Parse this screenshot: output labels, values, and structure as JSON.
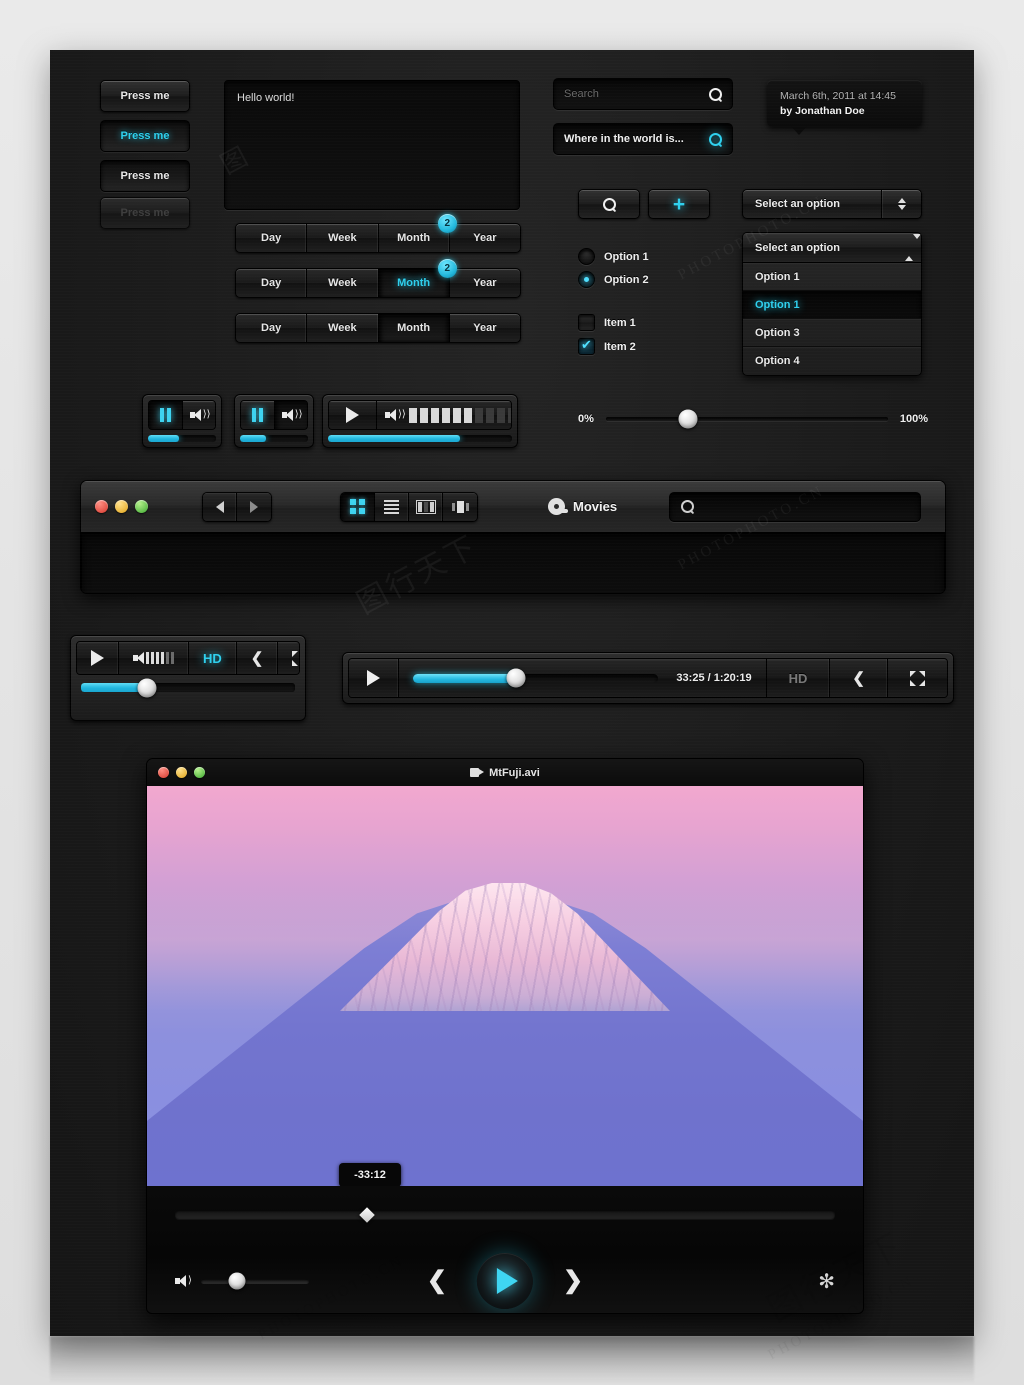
{
  "buttons": {
    "press_me_1": "Press me",
    "press_me_2": "Press me",
    "press_me_3": "Press me",
    "press_me_4": "Press me"
  },
  "textarea": {
    "value": "Hello world!"
  },
  "segmented": {
    "rows": [
      {
        "items": [
          "Day",
          "Week",
          "Month",
          "Year"
        ],
        "badge": "2",
        "badge_index": 2,
        "active_index": -1,
        "sunk_index": -1
      },
      {
        "items": [
          "Day",
          "Week",
          "Month",
          "Year"
        ],
        "badge": "2",
        "badge_index": 2,
        "active_index": 2,
        "sunk_index": 2
      },
      {
        "items": [
          "Day",
          "Week",
          "Month",
          "Year"
        ],
        "badge": "",
        "badge_index": -1,
        "active_index": -1,
        "sunk_index": 2
      }
    ]
  },
  "search": {
    "placeholder": "Search",
    "filled_value": "Where in the world is..."
  },
  "tooltip": {
    "line1": "March 6th, 2011 at 14:45",
    "line2": "by Jonathan Doe"
  },
  "icon_buttons": {
    "search_label": "search-icon",
    "add_label": "plus-icon"
  },
  "radios": [
    {
      "label": "Option 1",
      "checked": false
    },
    {
      "label": "Option 2",
      "checked": true
    }
  ],
  "checkboxes": [
    {
      "label": "Item 1",
      "checked": false
    },
    {
      "label": "Item 2",
      "checked": true
    }
  ],
  "select_closed": {
    "value": "Select an option"
  },
  "select_open": {
    "value": "Select an option",
    "options": [
      {
        "label": "Option 1",
        "selected": false
      },
      {
        "label": "Option 1",
        "selected": true
      },
      {
        "label": "Option 3",
        "selected": false
      },
      {
        "label": "Option 4",
        "selected": false
      }
    ]
  },
  "mini_players": [
    {
      "state": "pause",
      "progress_percent": 45
    },
    {
      "state": "pause",
      "progress_percent": 38
    },
    {
      "state": "play",
      "progress_percent": 72,
      "volume_blocks_on": 6,
      "volume_blocks_total": 10
    }
  ],
  "range_slider": {
    "min_label": "0%",
    "max_label": "100%",
    "value_percent": 29
  },
  "movies_window": {
    "title": "Movies",
    "view_modes": [
      "grid-view",
      "list-view",
      "column-view",
      "coverflow-view"
    ],
    "active_view_index": 0,
    "search_value": ""
  },
  "player_small": {
    "hd_label": "HD",
    "volume_percent": 31,
    "controls": [
      "play-button",
      "volume-eq",
      "hd-toggle",
      "share-button",
      "fullscreen-button"
    ]
  },
  "player_wide": {
    "time_display": "33:25 / 1:20:19",
    "hd_label": "HD",
    "progress_percent": 42
  },
  "video_window": {
    "title": "MtFuji.avi",
    "time_tooltip": "-33:12",
    "scrub_percent": 25,
    "volume_percent": 33
  },
  "colors": {
    "accent_cyan": "#2fd0ee",
    "canvas_bg": "#1b1b1b",
    "page_bg": "#e8e8e8",
    "light_red": "#d6382c",
    "light_yellow": "#e0a319",
    "light_green": "#3ca82f"
  },
  "watermarks": {
    "text": "PHOTOPHOTO.CN"
  }
}
